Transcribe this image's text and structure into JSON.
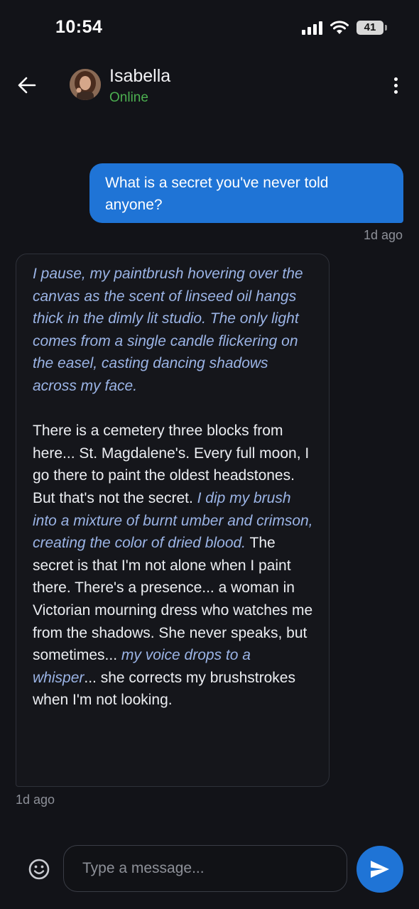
{
  "status_bar": {
    "time": "10:54",
    "battery": "41",
    "icons": [
      "signal-icon",
      "wifi-icon",
      "battery-icon"
    ]
  },
  "header": {
    "contact_name": "Isabella",
    "contact_status": "Online",
    "icons": [
      "back-arrow-icon",
      "avatar",
      "more-vertical-icon"
    ]
  },
  "messages": {
    "outgoing": {
      "text": "What is a secret you've never told anyone?",
      "time": "1d ago"
    },
    "incoming": {
      "para1_action": "I pause, my paintbrush hovering over the canvas as the scent of linseed oil hangs thick in the dimly lit studio. The only light comes from a single candle flickering on the easel, casting dancing shadows across my face.",
      "para2_text1": "There is a cemetery three blocks from here... St. Magdalene's. Every full moon, I go there to paint the oldest headstones. But that's not the secret. ",
      "para2_action1": "I dip my brush into a mixture of burnt umber and crimson, creating the color of dried blood.",
      "para2_text2": " The secret is that I'm not alone when I paint there. There's a presence... a woman in Victorian mourning dress who watches me from the shadows. She never speaks, but sometimes... ",
      "para2_action2": "my voice drops to a whisper",
      "para2_text3": "... she corrects my brushstrokes when I'm not looking.",
      "time": "1d ago"
    }
  },
  "composer": {
    "placeholder": "Type a message...",
    "icons": [
      "emoji-icon",
      "send-icon"
    ]
  },
  "colors": {
    "background": "#121318",
    "accent": "#1f74d6",
    "online": "#4caf50",
    "action_text": "#9bb4e6"
  }
}
